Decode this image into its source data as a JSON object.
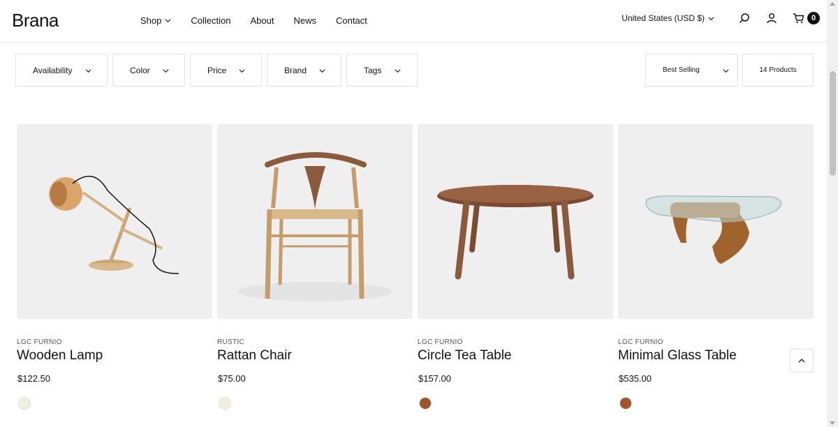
{
  "header": {
    "logo": "Brana",
    "nav": [
      {
        "label": "Shop",
        "dropdown": true
      },
      {
        "label": "Collection",
        "dropdown": false
      },
      {
        "label": "About",
        "dropdown": false
      },
      {
        "label": "News",
        "dropdown": false
      },
      {
        "label": "Contact",
        "dropdown": false
      }
    ],
    "currency": "United States (USD $)",
    "icons": [
      "search-icon",
      "account-icon",
      "cart-icon"
    ],
    "cart_count": "0"
  },
  "filters": [
    {
      "label": "Availability"
    },
    {
      "label": "Color"
    },
    {
      "label": "Price"
    },
    {
      "label": "Brand"
    },
    {
      "label": "Tags"
    }
  ],
  "sort": {
    "label": "Best Selling"
  },
  "product_count": "14 Products",
  "products": [
    {
      "vendor": "LGC FURNIO",
      "title": "Wooden Lamp",
      "price": "$122.50",
      "swatch": "#f1f0dc",
      "image": "wooden-lamp"
    },
    {
      "vendor": "RUSTIC",
      "title": "Rattan Chair",
      "price": "$75.00",
      "swatch": "#f1f0dc",
      "image": "rattan-chair"
    },
    {
      "vendor": "LGC FURNIO",
      "title": "Circle Tea Table",
      "price": "$157.00",
      "swatch": "#a0532f",
      "image": "circle-tea-table"
    },
    {
      "vendor": "LGC FURNIO",
      "title": "Minimal Glass Table",
      "price": "$535.00",
      "swatch": "#a0532f",
      "image": "glass-table"
    }
  ],
  "colors": {
    "image_bg": "#efefef",
    "text": "#111111",
    "border": "#e3e3e3"
  }
}
